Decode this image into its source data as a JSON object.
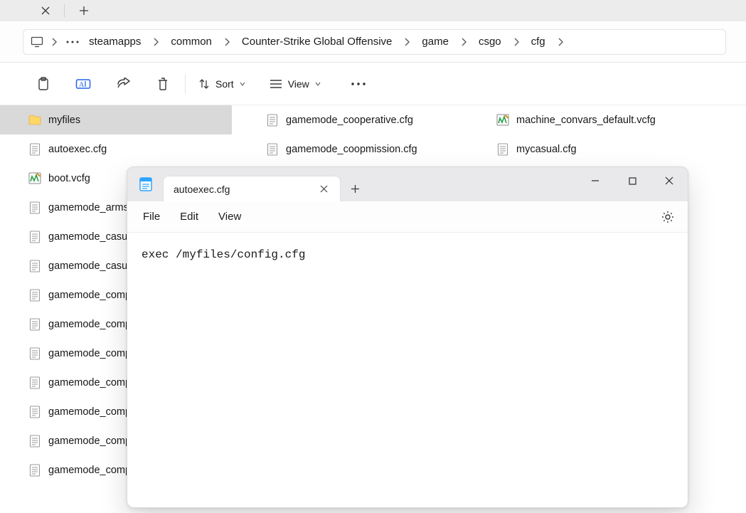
{
  "tabstrip": {
    "close_title": "Close tab",
    "new_title": "New tab"
  },
  "breadcrumb": {
    "items": [
      "steamapps",
      "common",
      "Counter-Strike Global Offensive",
      "game",
      "csgo",
      "cfg"
    ]
  },
  "toolbar": {
    "sort": "Sort",
    "view": "View"
  },
  "columns": {
    "col1": [
      {
        "name": "myfiles",
        "icon": "folder",
        "selected": true
      },
      {
        "name": "autoexec.cfg",
        "icon": "text"
      },
      {
        "name": "boot.vcfg",
        "icon": "vcfg"
      },
      {
        "name": "gamemode_arms",
        "icon": "text"
      },
      {
        "name": "gamemode_casua",
        "icon": "text"
      },
      {
        "name": "gamemode_casua",
        "icon": "text"
      },
      {
        "name": "gamemode_comp",
        "icon": "text"
      },
      {
        "name": "gamemode_comp",
        "icon": "text"
      },
      {
        "name": "gamemode_comp",
        "icon": "text"
      },
      {
        "name": "gamemode_comp",
        "icon": "text"
      },
      {
        "name": "gamemode_comp",
        "icon": "text"
      },
      {
        "name": "gamemode_comp",
        "icon": "text"
      },
      {
        "name": "gamemode_comp",
        "icon": "text"
      }
    ],
    "col2": [
      {
        "name": "gamemode_cooperative.cfg",
        "icon": "text"
      },
      {
        "name": "gamemode_coopmission.cfg",
        "icon": "text"
      }
    ],
    "col3": [
      {
        "name": "machine_convars_default.vcfg",
        "icon": "vcfg"
      },
      {
        "name": "mycasual.cfg",
        "icon": "text"
      }
    ]
  },
  "notepad": {
    "tab_title": "autoexec.cfg",
    "menu": {
      "file": "File",
      "edit": "Edit",
      "view": "View"
    },
    "content": "exec /myfiles/config.cfg"
  }
}
